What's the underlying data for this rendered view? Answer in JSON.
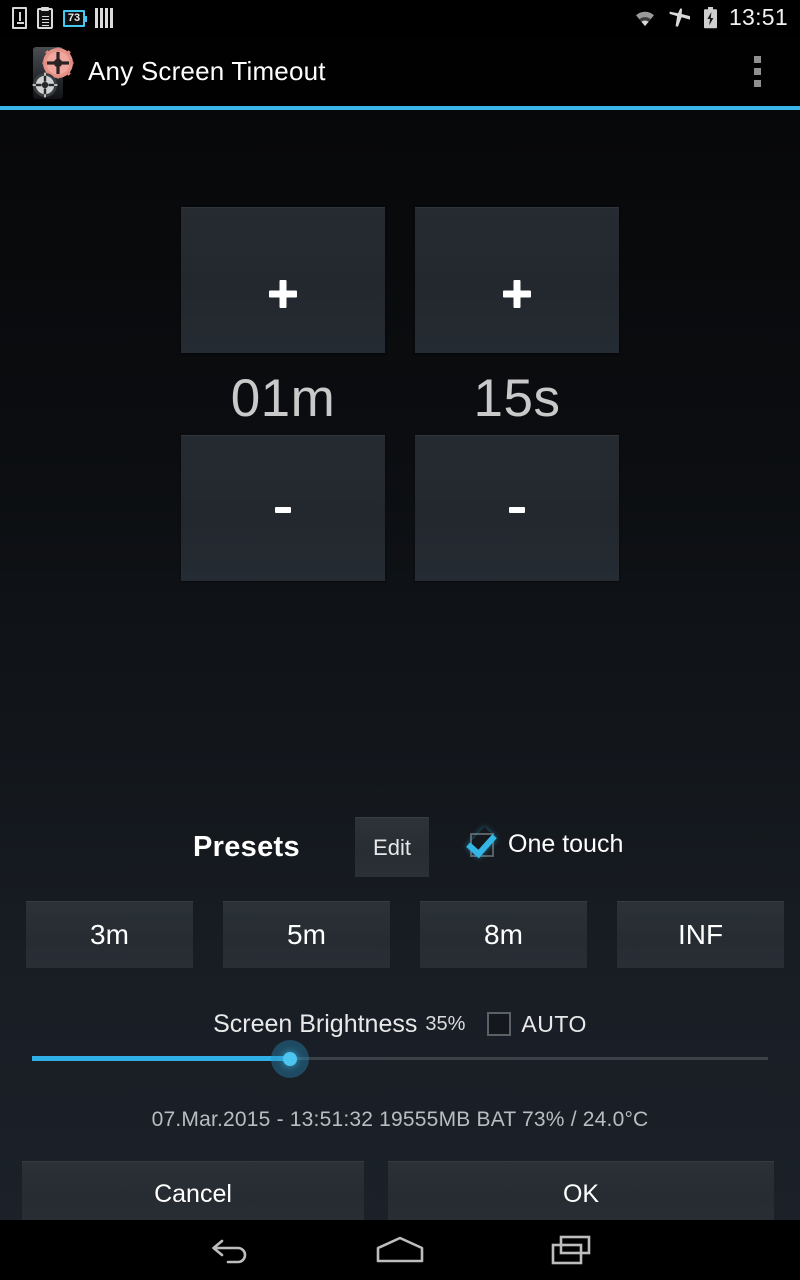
{
  "status_bar": {
    "left_icons": [
      {
        "name": "download-icon",
        "glyph": "download"
      },
      {
        "name": "clipboard-icon",
        "glyph": "clipboard"
      },
      {
        "name": "battery-percent-badge-icon",
        "glyph": "73"
      },
      {
        "name": "signal-bars-icon",
        "glyph": "bars"
      }
    ],
    "battery_badge_value": "73",
    "right_icons": [
      {
        "name": "wifi-icon",
        "glyph": "wifi"
      },
      {
        "name": "airplane-mode-icon",
        "glyph": "airplane"
      },
      {
        "name": "battery-charging-icon",
        "glyph": "battery-bolt"
      }
    ],
    "clock": "13:51"
  },
  "action_bar": {
    "app_icon_name": "app-icon-gears",
    "title": "Any Screen Timeout",
    "overflow_menu_label": "More options",
    "divider_color": "#39b5e8"
  },
  "timer": {
    "minutes": {
      "increment_label": "+",
      "value": "01m",
      "decrement_label": "-"
    },
    "seconds": {
      "increment_label": "+",
      "value": "15s",
      "decrement_label": "-"
    }
  },
  "presets": {
    "heading": "Presets",
    "edit_label": "Edit",
    "one_touch": {
      "label": "One touch",
      "checked": true
    },
    "buttons": [
      {
        "label": "3m"
      },
      {
        "label": "5m"
      },
      {
        "label": "8m"
      },
      {
        "label": "INF"
      }
    ]
  },
  "brightness": {
    "title": "Screen Brightness",
    "percent_label": "35%",
    "percent_value": 35,
    "auto_label": "AUTO",
    "auto_checked": false,
    "slider_accent": "#30b0e6"
  },
  "status_line": "07.Mar.2015 - 13:51:32   19555MB   BAT 73% / 24.0°C",
  "footer": {
    "cancel_label": "Cancel",
    "ok_label": "OK"
  },
  "nav_bar": {
    "back_label": "Back",
    "home_label": "Home",
    "recents_label": "Recent apps"
  }
}
